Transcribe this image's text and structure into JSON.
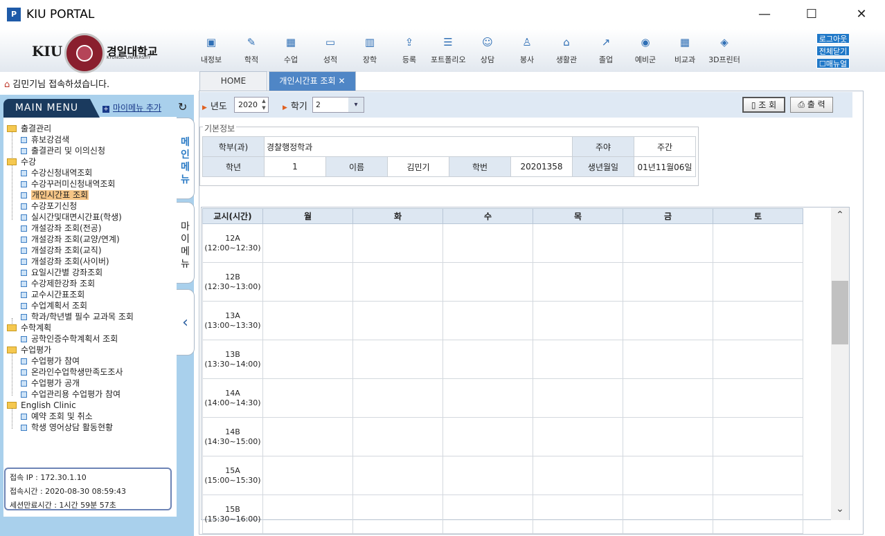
{
  "window": {
    "title": "KIU PORTAL",
    "app_icon": "P",
    "min": "—",
    "max": "☐",
    "close": "✕"
  },
  "logo": {
    "kiu": "KIU",
    "korean": "경일대학교",
    "english": "KYUNGIL UNIVERSITY"
  },
  "top_menu": [
    {
      "label": "내정보",
      "icon": "lock-icon"
    },
    {
      "label": "학적",
      "icon": "edit-icon"
    },
    {
      "label": "수업",
      "icon": "calendar-icon"
    },
    {
      "label": "성적",
      "icon": "monitor-icon"
    },
    {
      "label": "장학",
      "icon": "book-icon"
    },
    {
      "label": "등록",
      "icon": "upload-icon"
    },
    {
      "label": "포트폴리오",
      "icon": "list-icon"
    },
    {
      "label": "상담",
      "icon": "people-icon"
    },
    {
      "label": "봉사",
      "icon": "user-icon"
    },
    {
      "label": "생활관",
      "icon": "house-icon"
    },
    {
      "label": "졸업",
      "icon": "share-icon"
    },
    {
      "label": "예비군",
      "icon": "compass-icon"
    },
    {
      "label": "비교과",
      "icon": "calendar-icon"
    },
    {
      "label": "3D프린터",
      "icon": "cube-icon"
    }
  ],
  "right_buttons": {
    "logout": "로그아웃",
    "close_all": "전체닫기",
    "manual": "매뉴얼"
  },
  "welcome": "김민기님 접속하셨습니다.",
  "tabs": {
    "home": "HOME",
    "active": "개인시간표 조회",
    "close": "✕"
  },
  "menu": {
    "header": "MAIN MENU",
    "my_add": "마이메뉴 추가",
    "tree": [
      {
        "type": "folder",
        "label": "출결관리"
      },
      {
        "type": "leaf",
        "label": "휴보강검색"
      },
      {
        "type": "leaf",
        "label": "출결관리 및 이의신청"
      },
      {
        "type": "folder",
        "label": "수강"
      },
      {
        "type": "leaf",
        "label": "수강신청내역조회"
      },
      {
        "type": "leaf",
        "label": "수강꾸러미신청내역조회"
      },
      {
        "type": "leaf",
        "label": "개인시간표 조회",
        "active": true
      },
      {
        "type": "leaf",
        "label": "수강포기신청"
      },
      {
        "type": "leaf",
        "label": "실시간및대면시간표(학생)"
      },
      {
        "type": "leaf",
        "label": "개설강좌 조회(전공)"
      },
      {
        "type": "leaf",
        "label": "개설강좌 조회(교양/연계)"
      },
      {
        "type": "leaf",
        "label": "개설강좌 조회(교직)"
      },
      {
        "type": "leaf",
        "label": "개설강좌 조회(사이버)"
      },
      {
        "type": "leaf",
        "label": "요일시간별 강좌조회"
      },
      {
        "type": "leaf",
        "label": "수강제한강좌 조회"
      },
      {
        "type": "leaf",
        "label": "교수시간표조회"
      },
      {
        "type": "leaf",
        "label": "수업계획서 조회"
      },
      {
        "type": "leaf",
        "label": "학과/학년별 필수 교과목 조회"
      },
      {
        "type": "folder",
        "label": "수학계획"
      },
      {
        "type": "leaf",
        "label": "공학인증수학계획서 조회"
      },
      {
        "type": "folder",
        "label": "수업평가"
      },
      {
        "type": "leaf",
        "label": "수업평가 참여"
      },
      {
        "type": "leaf",
        "label": "온라인수업학생만족도조사"
      },
      {
        "type": "leaf",
        "label": "수업평가 공개"
      },
      {
        "type": "leaf",
        "label": "수업관리용 수업평가 참여"
      },
      {
        "type": "folder",
        "label": "English Clinic"
      },
      {
        "type": "leaf",
        "label": "예약 조회 및 취소"
      },
      {
        "type": "leaf",
        "label": "학생 영어상담 활동현황"
      }
    ],
    "side_main": "메인메뉴",
    "side_my": "마이메뉴",
    "side_collapse": "‹"
  },
  "session": {
    "ip": "접속 IP  : 172.30.1.10",
    "time": "접속시간 : 2020-08-30 08:59:43",
    "expire": "세션만료시간 : 1시간 59분 57초"
  },
  "search": {
    "year_label": "년도",
    "year_value": "2020",
    "term_label": "학기",
    "term_value": "2",
    "search_btn": "조 회",
    "print_btn": "출 력"
  },
  "basic": {
    "legend": "기본정보",
    "dept_h": "학부(과)",
    "dept": "경찰행정학과",
    "daynight_h": "주야",
    "daynight": "주간",
    "grade_h": "학년",
    "grade": "1",
    "name_h": "이름",
    "name": "김민기",
    "id_h": "학번",
    "id": "20201358",
    "birth_h": "생년월일",
    "birth": "01년11월06일"
  },
  "timetable": {
    "headers": [
      "교시(시간)",
      "월",
      "화",
      "수",
      "목",
      "금",
      "토"
    ],
    "periods": [
      {
        "code": "12A",
        "time": "(12:00~12:30)"
      },
      {
        "code": "12B",
        "time": "(12:30~13:00)"
      },
      {
        "code": "13A",
        "time": "(13:00~13:30)"
      },
      {
        "code": "13B",
        "time": "(13:30~14:00)"
      },
      {
        "code": "14A",
        "time": "(14:00~14:30)"
      },
      {
        "code": "14B",
        "time": "(14:30~15:00)"
      },
      {
        "code": "15A",
        "time": "(15:00~15:30)"
      },
      {
        "code": "15B",
        "time": "(15:30~16:00)"
      }
    ]
  },
  "icons": {
    "home": "⌂",
    "refresh": "↻",
    "up": "⌃",
    "down": "⌄",
    "dropdown": "▾"
  }
}
